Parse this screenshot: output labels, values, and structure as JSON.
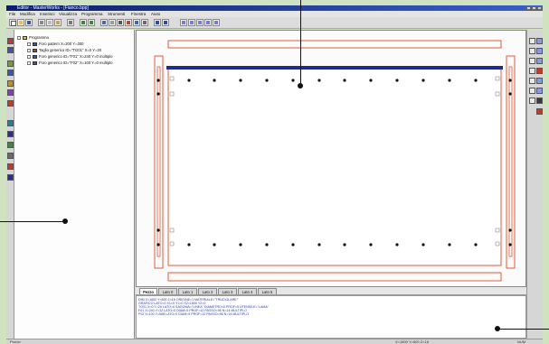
{
  "window": {
    "title": "Editor - MasterWorks - [Fianco.bpp]"
  },
  "menu": {
    "items": [
      "File",
      "Modifica",
      "Inserisci",
      "Visualizza",
      "Programma",
      "Strumenti",
      "Finestra",
      "Aiuto"
    ]
  },
  "toolbar": {
    "icons": [
      "new-file-icon",
      "open-folder-icon",
      "save-icon",
      "cut-icon",
      "copy-icon",
      "paste-icon",
      "print-icon",
      "undo-icon",
      "redo-icon",
      "zoom-icon",
      "grid-icon",
      "select-icon",
      "move-icon",
      "rotate-icon",
      "mirror-icon",
      "tool-a-icon",
      "tool-b-icon",
      "tool-c-icon"
    ]
  },
  "tree": {
    "root": "Programma",
    "items": [
      "Foro pattern X=200 Y=300",
      "Taglio generico ID=\"TG01\" X=0 Y=20",
      "Foro generico ID=\"F01\" X=240 Y=0 multiplo",
      "Foro generico ID=\"F02\" X=100 Y=0 multiplo"
    ]
  },
  "tabs": [
    "Pezzo",
    "Lato 0",
    "Lato 1",
    "Lato 2",
    "Lato 3",
    "Lato 4",
    "Lato 5"
  ],
  "active_tab": "Pezzo",
  "console": {
    "lines": [
      "DIM X=1800 Y=600 Z=18 ORIGINE=1 MATERIALE=\"TRUCIOLARE\"",
      "GRAFICO LATO=0 X1=0 Y1=0 X2=1800 Y2=0",
      "TG01 X=0 Y=20 LATO=0 SAGOMA=\"LINEA\" DIAMETRO=0 PROF=5 UTENSILE=\"LAMA\"",
      "F01 X=240 Y=32 LATO=0 DIAM=5 PROF=12 PASSO=96 N=14 MULTIPLO",
      "F02 X=100 Y=568 LATO=0 DIAM=5 PROF=12 PASSO=96 N=14 MULTIPLO"
    ]
  },
  "status": {
    "left": "Pronto",
    "middle": "X=1800 Y=600 Z=18",
    "right": "NUM"
  },
  "colors": {
    "background": "#cfe3c3",
    "titlebar": "#0b1d6e",
    "panel_outline": "#e25b3a",
    "groove": "#1e2d8c",
    "hole": "#111111"
  }
}
